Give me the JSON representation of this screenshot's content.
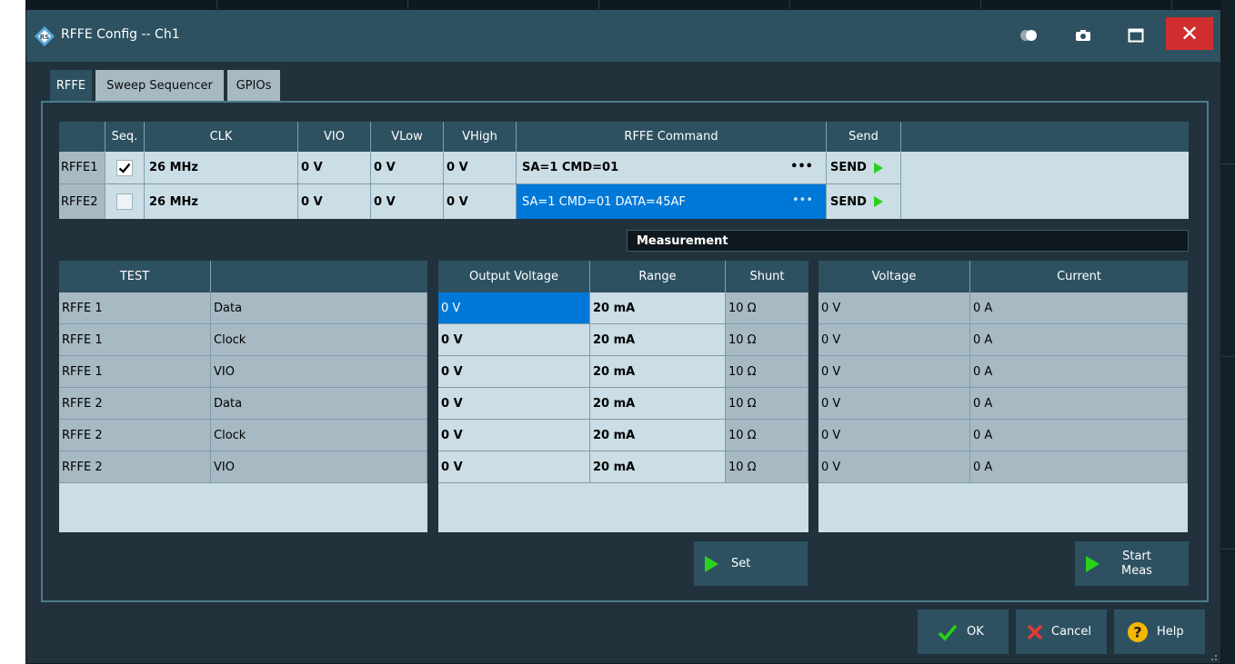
{
  "window": {
    "title": "RFFE Config -- Ch1"
  },
  "tabs": [
    {
      "label": "RFFE",
      "active": true
    },
    {
      "label": "Sweep Sequencer",
      "active": false
    },
    {
      "label": "GPIOs",
      "active": false
    }
  ],
  "rffe_table": {
    "headers": [
      "",
      "Seq.",
      "CLK",
      "VIO",
      "VLow",
      "VHigh",
      "RFFE Command",
      "Send"
    ],
    "rows": [
      {
        "name": "RFFE1",
        "seq_checked": true,
        "clk": "26 MHz",
        "vio": "0 V",
        "vlow": "0 V",
        "vhigh": "0 V",
        "command": "SA=1 CMD=01",
        "more": "•••",
        "send": "SEND",
        "selected": false
      },
      {
        "name": "RFFE2",
        "seq_checked": false,
        "clk": "26 MHz",
        "vio": "0 V",
        "vlow": "0 V",
        "vhigh": "0 V",
        "command": "SA=1 CMD=01 DATA=45AF",
        "more": "•••",
        "send": "SEND",
        "selected": true
      }
    ]
  },
  "measurement": {
    "label": "Measurement",
    "test_headers": [
      "TEST",
      ""
    ],
    "output_headers": [
      "Output Voltage",
      "Range",
      "Shunt"
    ],
    "result_headers": [
      "Voltage",
      "Current"
    ],
    "rows": [
      {
        "test": "RFFE 1",
        "signal": "Data",
        "output_voltage": "0 V",
        "range": "20 mA",
        "shunt": "10 Ω",
        "voltage": "0 V",
        "current": "0 A"
      },
      {
        "test": "RFFE 1",
        "signal": "Clock",
        "output_voltage": "0 V",
        "range": "20 mA",
        "shunt": "10 Ω",
        "voltage": "0 V",
        "current": "0 A"
      },
      {
        "test": "RFFE 1",
        "signal": "VIO",
        "output_voltage": "0 V",
        "range": "20 mA",
        "shunt": "10 Ω",
        "voltage": "0 V",
        "current": "0 A"
      },
      {
        "test": "RFFE 2",
        "signal": "Data",
        "output_voltage": "0 V",
        "range": "20 mA",
        "shunt": "10 Ω",
        "voltage": "0 V",
        "current": "0 A"
      },
      {
        "test": "RFFE 2",
        "signal": "Clock",
        "output_voltage": "0 V",
        "range": "20 mA",
        "shunt": "10 Ω",
        "voltage": "0 V",
        "current": "0 A"
      },
      {
        "test": "RFFE 2",
        "signal": "VIO",
        "output_voltage": "0 V",
        "range": "20 mA",
        "shunt": "10 Ω",
        "voltage": "0 V",
        "current": "0 A"
      }
    ],
    "set_label": "Set",
    "start_label_line1": "Start",
    "start_label_line2": "Meas"
  },
  "footer": {
    "ok_label": "OK",
    "cancel_label": "Cancel",
    "help_label": "Help"
  },
  "colors": {
    "titlebar": "#2e5161",
    "background": "#21323c",
    "selected": "#0078d7",
    "close": "#d02e2e",
    "play": "#29d21a"
  }
}
